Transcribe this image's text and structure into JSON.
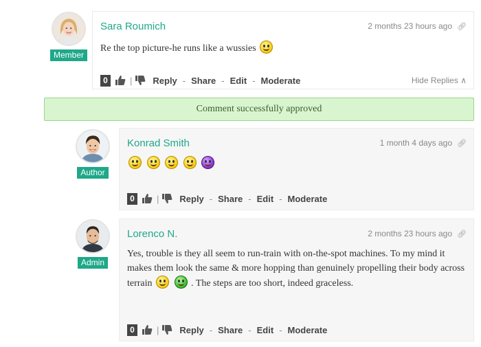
{
  "notice": {
    "text": "Comment successfully approved"
  },
  "comments": [
    {
      "author": "Sara Roumich",
      "role": "Member",
      "time": "2 months 23 hours ago",
      "text": "Re the top picture-he runs like a wussies",
      "votes": "0",
      "actions": [
        "Reply",
        "Share",
        "Edit",
        "Moderate"
      ],
      "hide_replies": "Hide Replies"
    },
    {
      "author": "Konrad Smith",
      "role": "Author",
      "time": "1 month 4 days ago",
      "votes": "0",
      "actions": [
        "Reply",
        "Share",
        "Edit",
        "Moderate"
      ]
    },
    {
      "author": "Lorenco N.",
      "role": "Admin",
      "time": "2 months 23 hours ago",
      "text_part1": "Yes, trouble is they all seem to run-train with on-the-spot machines. To my mind it makes them look the same & more hopping than genuinely propelling their body across terrain",
      "text_part2": ". The steps are too short, indeed graceless.",
      "votes": "0",
      "actions": [
        "Reply",
        "Share",
        "Edit",
        "Moderate"
      ]
    }
  ],
  "icons": {
    "vote_up": "thumbs-up-icon",
    "vote_down": "thumbs-down-icon",
    "permalink": "link-icon",
    "collapse": "chevron-up-icon"
  },
  "colors": {
    "accent": "#1fa889",
    "notice_bg": "#d9f5d0",
    "notice_border": "#9ad48a"
  }
}
